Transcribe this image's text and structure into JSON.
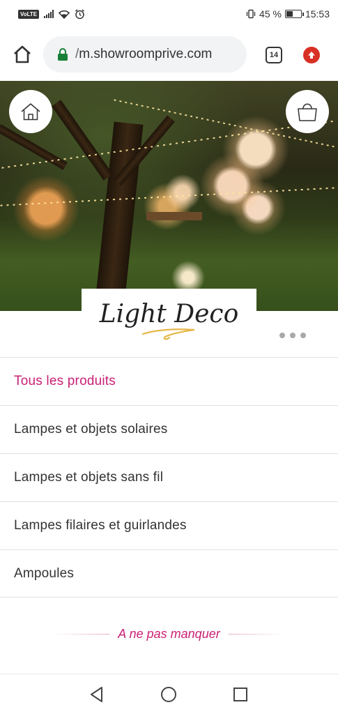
{
  "status_bar": {
    "left_icons": [
      "volte-icon",
      "signal-icon",
      "wifi-icon",
      "alarm-icon"
    ],
    "volte_label": "VoLTE",
    "battery_percent": "45 %",
    "battery_level": 0.45,
    "time": "15:53"
  },
  "browser": {
    "url": "m.showroomprive.com",
    "url_prefix": "/",
    "tab_count": "14",
    "accent_secure": "#188038",
    "update_color": "#d93025"
  },
  "hero": {
    "home_icon": "home-icon",
    "bag_icon": "shopping-bag-icon",
    "logo_text": "Light Deco",
    "more_icon": "more-dots-icon"
  },
  "menu": {
    "items": [
      {
        "label": "Tous les produits",
        "active": true
      },
      {
        "label": "Lampes et objets solaires",
        "active": false
      },
      {
        "label": "Lampes et objets sans fil",
        "active": false
      },
      {
        "label": "Lampes filaires et guirlandes",
        "active": false
      },
      {
        "label": "Ampoules",
        "active": false
      }
    ],
    "active_color": "#c91f74"
  },
  "section": {
    "title": "A ne pas manquer"
  },
  "nav_bar": {
    "buttons": [
      "back-icon",
      "home-circle-icon",
      "recent-apps-icon"
    ]
  }
}
